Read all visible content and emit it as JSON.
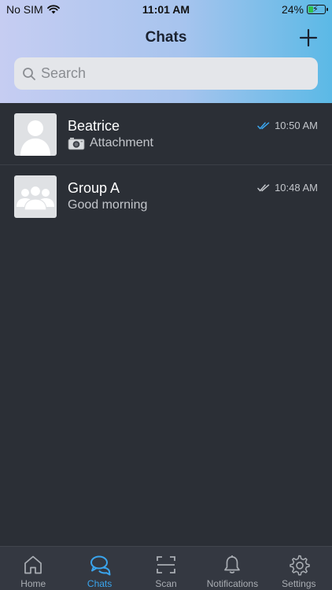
{
  "status_bar": {
    "carrier": "No SIM",
    "time": "11:01 AM",
    "battery": "24%"
  },
  "header": {
    "title": "Chats"
  },
  "search": {
    "placeholder": "Search"
  },
  "chats": [
    {
      "name": "Beatrice",
      "preview": "Attachment",
      "time": "10:50 AM",
      "read_status": "read"
    },
    {
      "name": "Group A",
      "preview": "Good morning",
      "time": "10:48 AM",
      "read_status": "delivered"
    }
  ],
  "tabs": [
    {
      "label": "Home",
      "icon": "home-icon"
    },
    {
      "label": "Chats",
      "icon": "chats-icon",
      "active": true
    },
    {
      "label": "Scan",
      "icon": "scan-icon"
    },
    {
      "label": "Notifications",
      "icon": "bell-icon"
    },
    {
      "label": "Settings",
      "icon": "gear-icon"
    }
  ],
  "colors": {
    "accent": "#3aa5ee",
    "background": "#2b2f36",
    "tabbar": "#343841"
  }
}
